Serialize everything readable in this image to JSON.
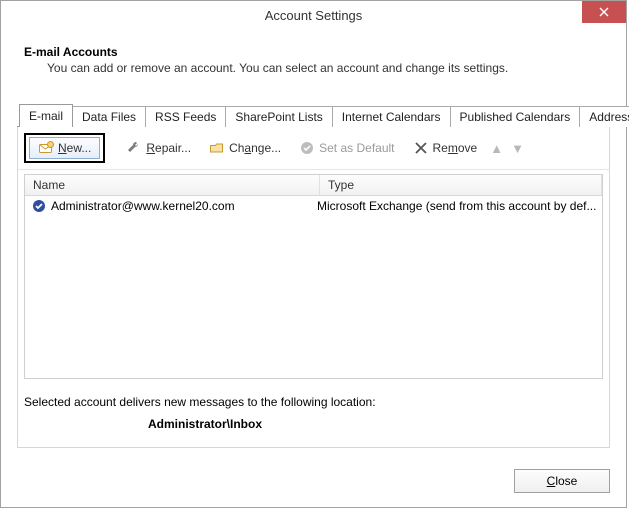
{
  "window": {
    "title": "Account Settings"
  },
  "header": {
    "title": "E-mail Accounts",
    "subtitle": "You can add or remove an account. You can select an account and change its settings."
  },
  "tabs": [
    {
      "label": "E-mail",
      "active": true
    },
    {
      "label": "Data Files"
    },
    {
      "label": "RSS Feeds"
    },
    {
      "label": "SharePoint Lists"
    },
    {
      "label": "Internet Calendars"
    },
    {
      "label": "Published Calendars"
    },
    {
      "label": "Address Books"
    }
  ],
  "toolbar": {
    "new": "New...",
    "repair": "Repair...",
    "change": "Change...",
    "set_default": "Set as Default",
    "remove": "Remove"
  },
  "table": {
    "columns": {
      "name": "Name",
      "type": "Type"
    },
    "rows": [
      {
        "name": "Administrator@www.kernel20.com",
        "type": "Microsoft Exchange (send from this account by def..."
      }
    ]
  },
  "location": {
    "text": "Selected account delivers new messages to the following location:",
    "path": "Administrator\\Inbox"
  },
  "footer": {
    "close": "Close"
  }
}
